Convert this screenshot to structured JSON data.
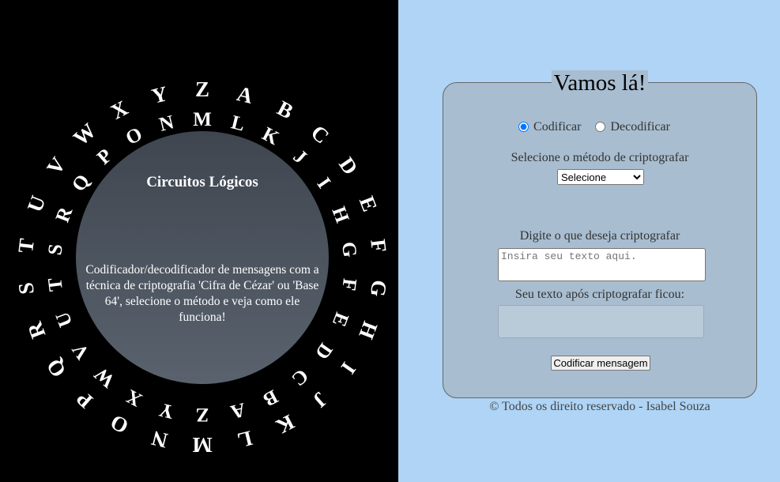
{
  "outer_ring": [
    "Z",
    "A",
    "B",
    "C",
    "D",
    "E",
    "F",
    "G",
    "H",
    "I",
    "J",
    "K",
    "L",
    "M",
    "N",
    "O",
    "P",
    "Q",
    "R",
    "S",
    "T",
    "U",
    "V",
    "W",
    "X",
    "Y"
  ],
  "inner_ring": [
    "M",
    "L",
    "K",
    "J",
    "I",
    "H",
    "G",
    "F",
    "E",
    "D",
    "C",
    "B",
    "A",
    "Z",
    "Y",
    "X",
    "W",
    "V",
    "U",
    "T",
    "S",
    "R",
    "Q",
    "P",
    "O",
    "N"
  ],
  "disc": {
    "title": "Circuitos Lógicos",
    "description": "Codificador/decodificador de mensagens com a técnica de criptografia 'Cifra de Cézar' ou 'Base 64', selecione o método e veja como ele funciona!"
  },
  "form": {
    "title": "Vamos lá!",
    "radio_encode": "Codificar",
    "radio_decode": "Decodificar",
    "method_label": "Selecione o método de criptografar",
    "method_selected": "Selecione",
    "input_label": "Digite o que deseja criptografar",
    "input_placeholder": "Insira seu texto aqui.",
    "output_label": "Seu texto após criptografar ficou:",
    "output_value": "",
    "submit_label": "Codificar mensagem"
  },
  "footer": "© Todos os direito reservado - Isabel Souza"
}
